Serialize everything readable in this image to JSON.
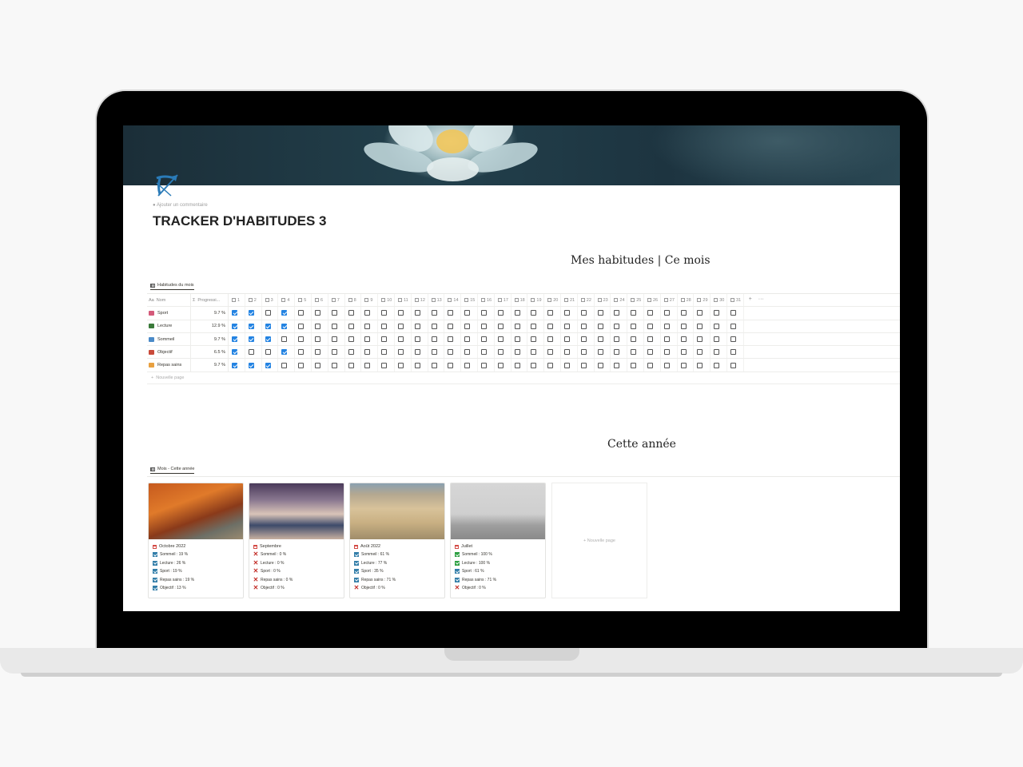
{
  "page": {
    "title": "TRACKER D'HABITUDES 3",
    "add_comment": "Ajouter un commentaire",
    "heading_month": "Mes habitudes | Ce mois",
    "heading_year": "Cette année",
    "icon": "bow-arrow-icon"
  },
  "habits_view": {
    "tab_label": "Habitudes du mois",
    "columns": {
      "name": "Nom",
      "progress": "Progressi...",
      "name_prefix": "Aa",
      "progress_prefix": "Σ"
    },
    "days": [
      "1",
      "2",
      "3",
      "4",
      "5",
      "6",
      "7",
      "8",
      "9",
      "10",
      "11",
      "12",
      "13",
      "14",
      "15",
      "16",
      "17",
      "18",
      "19",
      "20",
      "21",
      "22",
      "23",
      "24",
      "25",
      "26",
      "27",
      "28",
      "29",
      "30",
      "31"
    ],
    "add_column": "+",
    "more": "···",
    "new_page": "Nouvelle page",
    "rows": [
      {
        "name": "Sport",
        "progress": "9.7 %",
        "color": "#d45a7a",
        "checked": [
          1,
          2,
          4
        ]
      },
      {
        "name": "Lecture",
        "progress": "12.9 %",
        "color": "#3a7a3a",
        "checked": [
          1,
          2,
          3,
          4
        ]
      },
      {
        "name": "Sommeil",
        "progress": "9.7 %",
        "color": "#4a8ac8",
        "checked": [
          1,
          2,
          3
        ]
      },
      {
        "name": "Objectif",
        "progress": "6.5 %",
        "color": "#c94a3a",
        "checked": [
          1,
          4
        ]
      },
      {
        "name": "Repas sains",
        "progress": "9.7 %",
        "color": "#e8a040",
        "checked": [
          1,
          2,
          3
        ]
      }
    ]
  },
  "months_view": {
    "tab_label": "Mois - Cette année",
    "new_page": "+ Nouvelle page",
    "cards": [
      {
        "title": "Octobre 2022",
        "image": "autumn-park-image",
        "props": [
          {
            "label": "Sommeil : 19 %",
            "state": "blue"
          },
          {
            "label": "Lecture : 26 %",
            "state": "blue"
          },
          {
            "label": "Sport : 19 %",
            "state": "blue"
          },
          {
            "label": "Repas sains : 19 %",
            "state": "blue"
          },
          {
            "label": "Objectif : 13 %",
            "state": "blue"
          }
        ]
      },
      {
        "title": "Septembre",
        "image": "classroom-image",
        "props": [
          {
            "label": "Sommeil : 0 %",
            "state": "red"
          },
          {
            "label": "Lecture : 0 %",
            "state": "red"
          },
          {
            "label": "Sport : 0 %",
            "state": "red"
          },
          {
            "label": "Repas sains : 0 %",
            "state": "red"
          },
          {
            "label": "Objectif : 0 %",
            "state": "red"
          }
        ]
      },
      {
        "title": "Août 2022",
        "image": "beach-image",
        "props": [
          {
            "label": "Sommeil : 61 %",
            "state": "blue"
          },
          {
            "label": "Lecture : 77 %",
            "state": "blue"
          },
          {
            "label": "Sport : 35 %",
            "state": "blue"
          },
          {
            "label": "Repas sains : 71 %",
            "state": "blue"
          },
          {
            "label": "Objectif : 0 %",
            "state": "red"
          }
        ]
      },
      {
        "title": "Juillet",
        "image": "first-flight-image",
        "props": [
          {
            "label": "Sommeil : 100 %",
            "state": "green"
          },
          {
            "label": "Lecture : 100 %",
            "state": "green"
          },
          {
            "label": "Sport : 61 %",
            "state": "blue"
          },
          {
            "label": "Repas sains : 71 %",
            "state": "blue"
          },
          {
            "label": "Objectif : 0 %",
            "state": "red"
          }
        ]
      }
    ]
  }
}
